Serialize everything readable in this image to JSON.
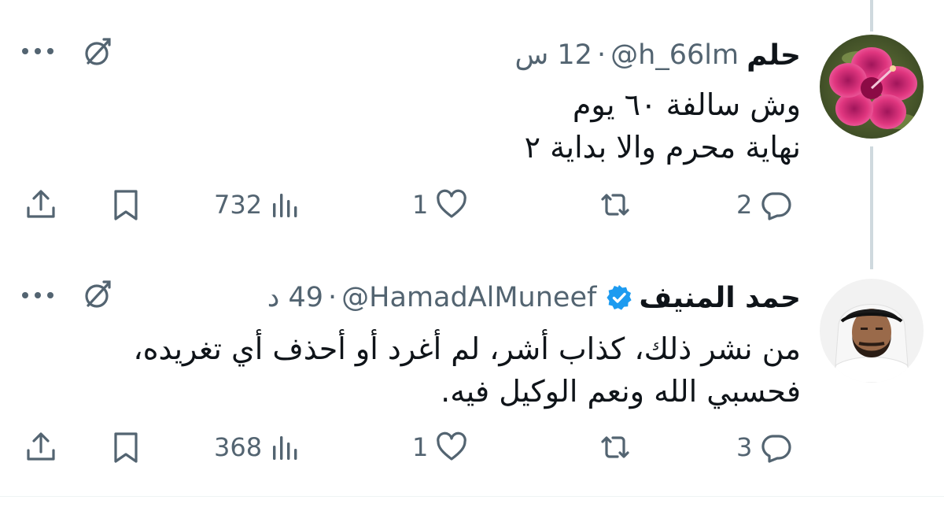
{
  "tweets": [
    {
      "author_name": "حلم",
      "handle": "@h_66lm",
      "separator": "·",
      "time": "12 س",
      "verified": false,
      "lines": [
        "وش سالفة ٦٠ يوم",
        "نهاية محرم والا بداية ٢"
      ],
      "replies": "2",
      "reposts": "",
      "likes": "1",
      "views": "732",
      "avatar": "flower-avatar"
    },
    {
      "author_name": "حمد المنيف",
      "handle": "@HamadAlMuneef",
      "separator": "·",
      "time": "49 د",
      "verified": true,
      "lines": [
        "من نشر ذلك، كذاب أشر، لم أغرد أو أحذف أي تغريده،",
        "فحسبي الله ونعم الوكيل فيه."
      ],
      "replies": "3",
      "reposts": "",
      "likes": "1",
      "views": "368",
      "avatar": "person-avatar"
    }
  ],
  "colors": {
    "text_primary": "#0f1419",
    "text_secondary": "#536471",
    "verified_blue": "#1d9bf0",
    "thread_line": "#cfd9de"
  },
  "icons": [
    "more-icon",
    "grok-icon",
    "reply-icon",
    "repost-icon",
    "like-icon",
    "views-icon",
    "bookmark-icon",
    "share-icon",
    "verified-badge-icon"
  ]
}
